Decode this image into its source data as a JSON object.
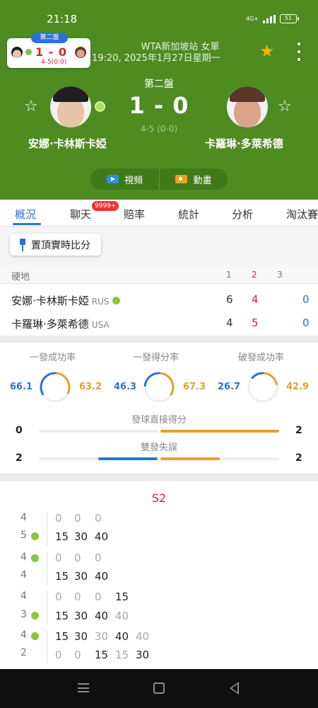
{
  "status_bar": {
    "time": "21:18",
    "network_label": "4G+",
    "battery": "51"
  },
  "mini_card": {
    "set_label": "第二盤",
    "score": "1 - 0",
    "sub": "4-5(0:0)"
  },
  "header": {
    "tournament": "WTA新加坡站 女單",
    "datetime": "19:20, 2025年1月27日星期一",
    "set_label": "第二盤",
    "score": "1 - 0",
    "game_score": "4-5 (0-0)"
  },
  "players": {
    "left": {
      "name": "安娜·卡林斯卡婭",
      "country": "RUS"
    },
    "right": {
      "name": "卡羅琳·多萊希德",
      "country": "USA"
    }
  },
  "media": {
    "video_label": "視頻",
    "animation_label": "動畫"
  },
  "tabs": [
    {
      "label": "概況"
    },
    {
      "label": "聊天"
    },
    {
      "label": "賠率"
    },
    {
      "label": "統計"
    },
    {
      "label": "分析"
    },
    {
      "label": "淘汰賽"
    }
  ],
  "chat_badge": "9999+",
  "pin_button": "置頂實時比分",
  "score_table": {
    "surface": "硬地",
    "sets": [
      "1",
      "2",
      "3"
    ],
    "rows": [
      {
        "set1": "6",
        "set2": "4",
        "game": "0"
      },
      {
        "set1": "4",
        "set2": "5",
        "game": "0"
      }
    ]
  },
  "stats": {
    "rings": [
      {
        "title": "一發成功率",
        "left": "66.1",
        "right": "63.2",
        "left_value": 66.1,
        "right_value": 63.2
      },
      {
        "title": "一發得分率",
        "left": "46.3",
        "right": "67.3",
        "left_value": 46.3,
        "right_value": 67.3
      },
      {
        "title": "破發成功率",
        "left": "26.7",
        "right": "42.9",
        "left_value": 26.7,
        "right_value": 42.9
      }
    ],
    "aces": {
      "title": "發球直接得分",
      "left": "0",
      "right": "2"
    },
    "double_faults": {
      "title": "雙發失誤",
      "left": "2",
      "right": "2"
    }
  },
  "point_by_point": {
    "set_title": "S2",
    "games": [
      {
        "top": "4",
        "bottom": "5",
        "top_points": [
          "0",
          "0",
          "0"
        ],
        "bottom_points": [
          "15",
          "30",
          "40"
        ]
      },
      {
        "top": "4",
        "bottom": "4",
        "top_points": [
          "0",
          "0",
          "0"
        ],
        "bottom_points": [
          "15",
          "30",
          "40"
        ]
      },
      {
        "top": "4",
        "bottom": "3",
        "top_points": [
          "0",
          "0",
          "0",
          "15"
        ],
        "bottom_points": [
          "15",
          "30",
          "40",
          "40"
        ]
      },
      {
        "top": "4",
        "bottom": "2",
        "top_points": [
          "15",
          "30",
          "30",
          "40",
          "40"
        ],
        "bottom_points": [
          "0",
          "0",
          "15",
          "15",
          "30"
        ]
      }
    ]
  },
  "colors": {
    "header_green": "#4e8c22",
    "accent_blue": "#2c72d6",
    "accent_yellow": "#e3a22a",
    "score_red": "#d6262c"
  }
}
